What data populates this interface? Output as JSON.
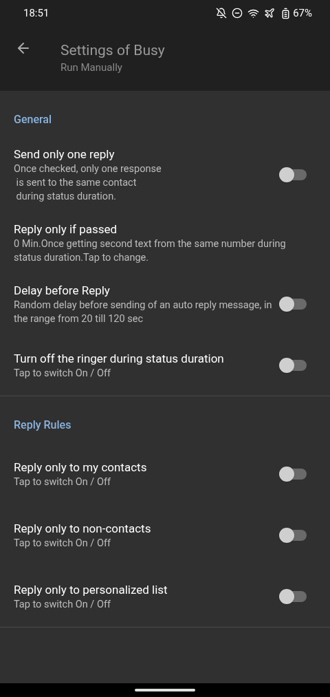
{
  "status_bar": {
    "time": "18:51",
    "battery": "67%"
  },
  "app_bar": {
    "title": "Settings of Busy",
    "subtitle": "Run Manually"
  },
  "sections": [
    {
      "header": "General",
      "items": [
        {
          "kind": "switch",
          "title": "Send only one reply",
          "summary": "Once checked, only one response\n is sent to the same contact\n during status duration.",
          "on": false
        },
        {
          "kind": "text",
          "title": "Reply only if passed",
          "summary": "0 Min.Once getting second text from the same number during status duration.Tap to change."
        },
        {
          "kind": "switch",
          "title": "Delay before Reply",
          "summary": "Random delay before sending of an auto reply message, in the range from 20 till 120 sec",
          "on": false
        },
        {
          "kind": "switch",
          "title": "Turn off the ringer during status duration",
          "summary": "Tap to switch On / Off",
          "on": false
        }
      ]
    },
    {
      "header": "Reply Rules",
      "items": [
        {
          "kind": "switch",
          "title": "Reply only to my contacts",
          "summary": "Tap to switch On / Off",
          "on": false
        },
        {
          "kind": "switch",
          "title": "Reply only to non-contacts",
          "summary": "Tap to switch On / Off",
          "on": false
        },
        {
          "kind": "switch",
          "title": "Reply only to personalized list",
          "summary": "Tap to switch On / Off",
          "on": false
        }
      ]
    }
  ]
}
